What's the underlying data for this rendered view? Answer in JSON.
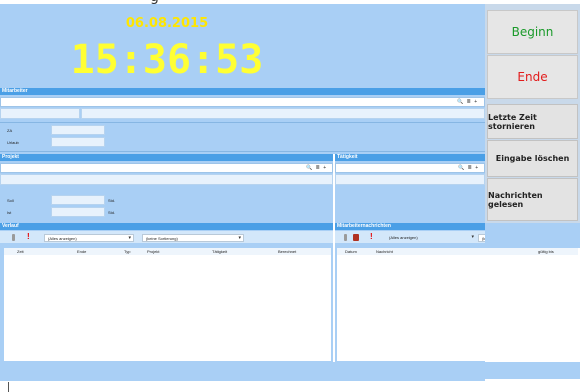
{
  "window_top_text": "g",
  "clock": {
    "date": "06.08.2015",
    "time": "15:36:53"
  },
  "buttons": {
    "beginn": "Beginn",
    "ende": "Ende",
    "letzte_zeit": "Letzte Zeit stornieren",
    "eingabe_loeschen": "Eingabe löschen",
    "nachrichten_gelesen": "Nachrichten gelesen"
  },
  "mitarbeiter": {
    "header": "Mitarbeiter",
    "za_label": "ZA",
    "urlaub_label": "Urlaub"
  },
  "projekt": {
    "header": "Projekt",
    "soll_label": "Soll",
    "ist_label": "Ist",
    "unit": "Std."
  },
  "taetigkeit": {
    "header": "Tätigkeit"
  },
  "field_icons": "🔍 ≣ +",
  "verlauf": {
    "header": "Verlauf",
    "filter": "(Alles anzeigen)",
    "sort": "(keine Sortierung)",
    "columns": [
      "Zeit",
      "Ende",
      "Typ",
      "Projekt",
      "Tätigkeit",
      "Berechnet"
    ]
  },
  "nachrichten": {
    "header": "Mitarbeiternachrichten",
    "filter": "(Alles anzeigen)",
    "sort": "(keine Sortierung)",
    "columns": [
      "Datum",
      "Nachricht",
      "gültig bis"
    ]
  },
  "colors": {
    "panel": "#a9cff5",
    "header": "#4a9fe6",
    "date": "#ffe600",
    "clock": "#ffff33",
    "beginn_text": "#1a9a2a",
    "ende_text": "#e21b1b",
    "flag": "#e60000"
  }
}
